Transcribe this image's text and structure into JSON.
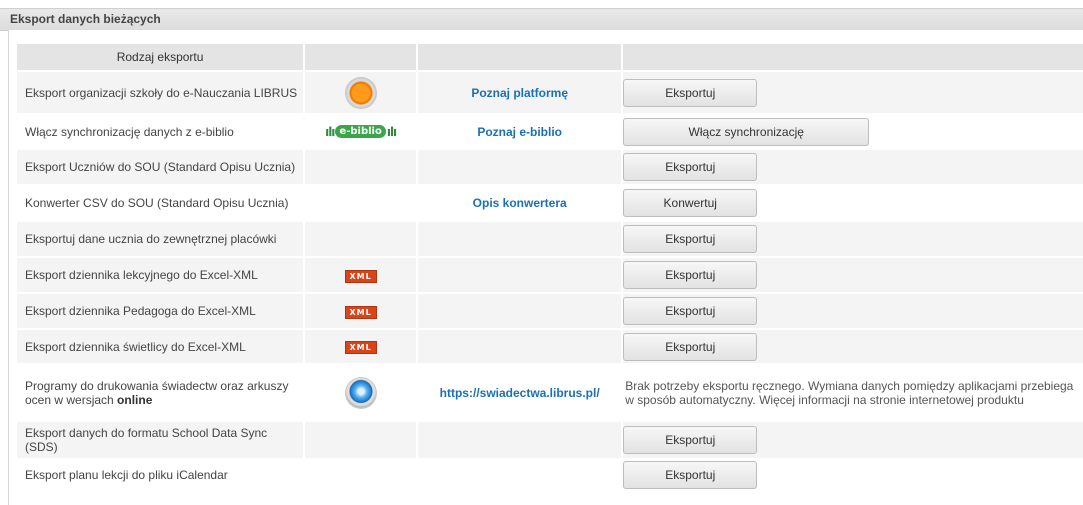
{
  "panel": {
    "title": "Eksport danych bieżących"
  },
  "table": {
    "header_type": "Rodzaj eksportu",
    "rows": [
      {
        "name": "Eksport organizacji szkoły do e-Nauczania LIBRUS",
        "icon": "orange-sphere-icon",
        "link": "Poznaj platformę",
        "button": "Eksportuj"
      },
      {
        "name": "Włącz synchronizację danych z e-biblio",
        "icon": "e-biblio-logo",
        "logo_text": "e-biblio",
        "link": "Poznaj e-biblio",
        "button": "Włącz synchronizację"
      },
      {
        "name": "Eksport Uczniów do SOU (Standard Opisu Ucznia)",
        "icon": "",
        "link": "",
        "button": "Eksportuj"
      },
      {
        "name": "Konwerter CSV do SOU (Standard Opisu Ucznia)",
        "icon": "",
        "link": "Opis konwertera",
        "button": "Konwertuj"
      },
      {
        "name": "Eksportuj dane ucznia do zewnętrznej placówki",
        "icon": "",
        "link": "",
        "button": "Eksportuj"
      },
      {
        "name": "Eksport dziennika lekcyjnego do Excel-XML",
        "icon": "xml-badge-icon",
        "badge": "XML",
        "link": "",
        "button": "Eksportuj"
      },
      {
        "name": "Eksport dziennika Pedagoga do Excel-XML",
        "icon": "xml-badge-icon",
        "badge": "XML",
        "link": "",
        "button": "Eksportuj"
      },
      {
        "name": "Eksport dziennika świetlicy do Excel-XML",
        "icon": "xml-badge-icon",
        "badge": "XML",
        "link": "",
        "button": "Eksportuj"
      },
      {
        "name_prefix": "Programy do drukowania świadectw oraz arkuszy ocen w wersjach ",
        "name_bold": "online",
        "icon": "blue-sphere-icon",
        "link": "https://swiadectwa.librus.pl/",
        "description": "Brak potrzeby eksportu ręcznego. Wymiana danych pomiędzy aplikacjami przebiega w sposób automatyczny. Więcej informacji na stronie internetowej produktu"
      },
      {
        "name": "Eksport danych do formatu School Data Sync (SDS)",
        "icon": "",
        "link": "",
        "button": "Eksportuj"
      },
      {
        "name": "Eksport planu lekcji do pliku iCalendar",
        "icon": "",
        "link": "",
        "button": "Eksportuj"
      }
    ]
  },
  "colors": {
    "link": "#1b6fb8",
    "xml_badge": "#d8451a",
    "ebiblio_green": "#3aa64a"
  }
}
